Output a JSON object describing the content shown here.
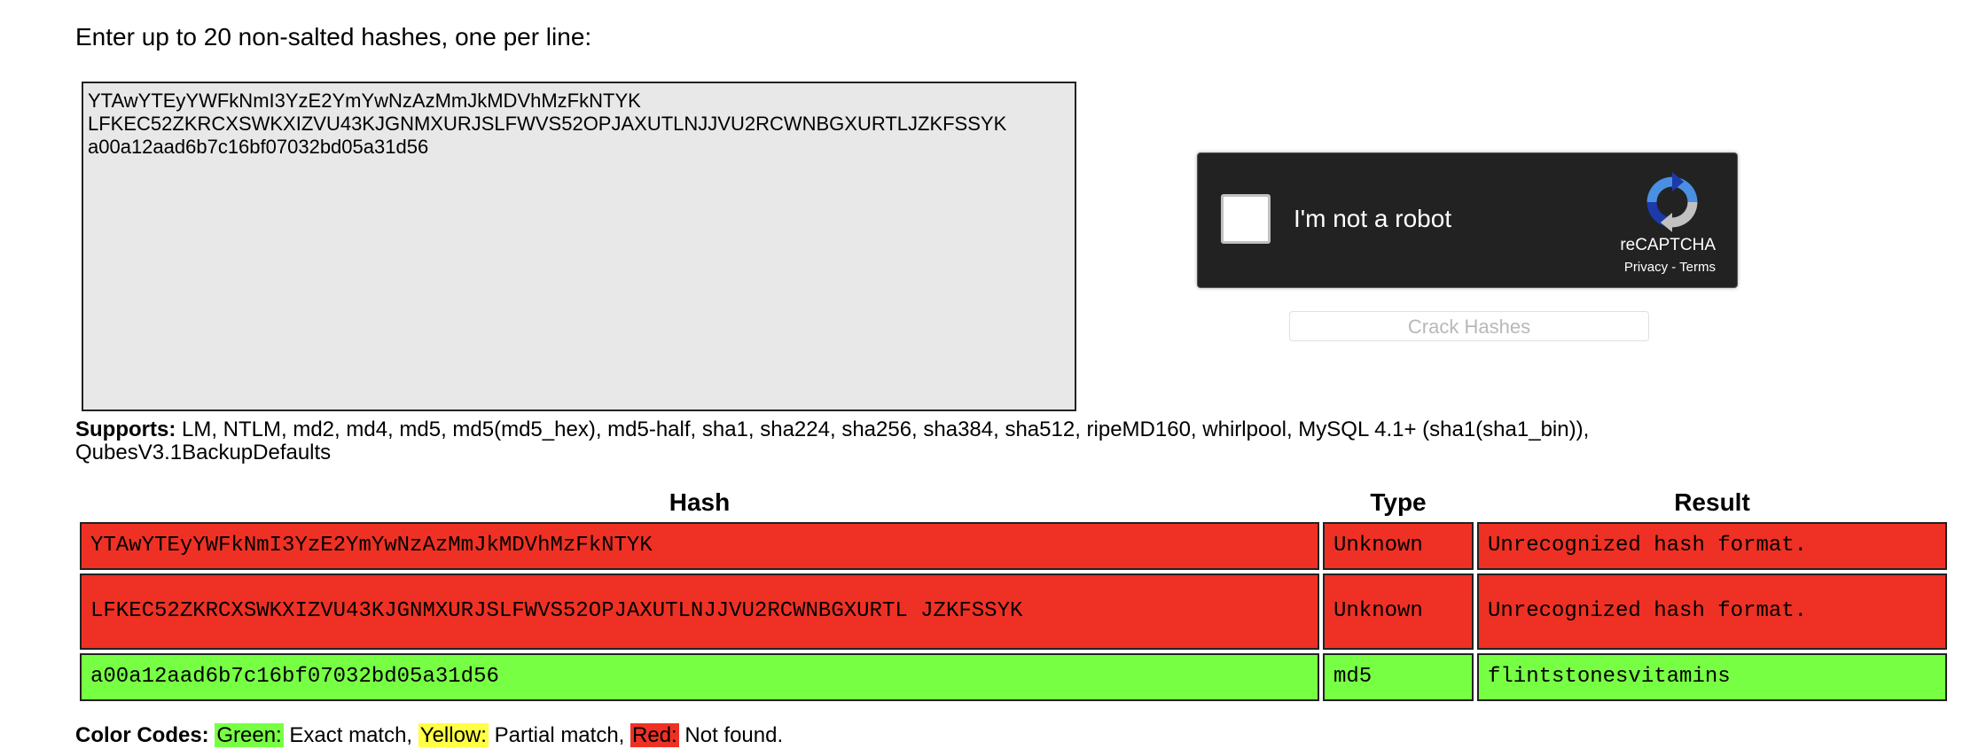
{
  "prompt": "Enter up to 20 non-salted hashes, one per line:",
  "input": {
    "value": "YTAwYTEyYWFkNmI3YzE2YmYwNzAzMmJkMDVhMzFkNTYK\nLFKEC52ZKRCXSWKXIZVU43KJGNMXURJSLFWVS52OPJAXUTLNJJVU2RCWNBGXURTLJZKFSSYK\na00a12aad6b7c16bf07032bd05a31d56"
  },
  "recaptcha": {
    "label": "I'm not a robot",
    "brand": "reCAPTCHA",
    "privacy": "Privacy",
    "separator": " - ",
    "terms": "Terms"
  },
  "crack_button": "Crack Hashes",
  "supports": {
    "label": "Supports:",
    "text": " LM, NTLM, md2, md4, md5, md5(md5_hex), md5-half, sha1, sha224, sha256, sha384, sha512, ripeMD160, whirlpool, MySQL 4.1+ (sha1(sha1_bin)), QubesV3.1BackupDefaults"
  },
  "table": {
    "headers": {
      "hash": "Hash",
      "type": "Type",
      "result": "Result"
    },
    "rows": [
      {
        "hash": "YTAwYTEyYWFkNmI3YzE2YmYwNzAzMmJkMDVhMzFkNTYK",
        "type": "Unknown",
        "result": "Unrecognized hash format.",
        "status": "red"
      },
      {
        "hash": "LFKEC52ZKRCXSWKXIZVU43KJGNMXURJSLFWVS52OPJAXUTLNJJVU2RCWNBGXURTL JZKFSSYK",
        "type": "Unknown",
        "result": "Unrecognized hash format.",
        "status": "red"
      },
      {
        "hash": "a00a12aad6b7c16bf07032bd05a31d56",
        "type": "md5",
        "result": "flintstonesvitamins",
        "status": "green"
      }
    ]
  },
  "color_codes": {
    "label": "Color Codes:",
    "green": "Green:",
    "green_desc": " Exact match, ",
    "yellow": "Yellow:",
    "yellow_desc": " Partial match, ",
    "red": "Red:",
    "red_desc": " Not found."
  },
  "colors": {
    "red": "#ee3124",
    "green": "#77ff44",
    "yellow": "#ffff44",
    "captcha_bg": "#222222"
  },
  "icons": {
    "recaptcha_logo": "recaptcha-logo-icon"
  }
}
